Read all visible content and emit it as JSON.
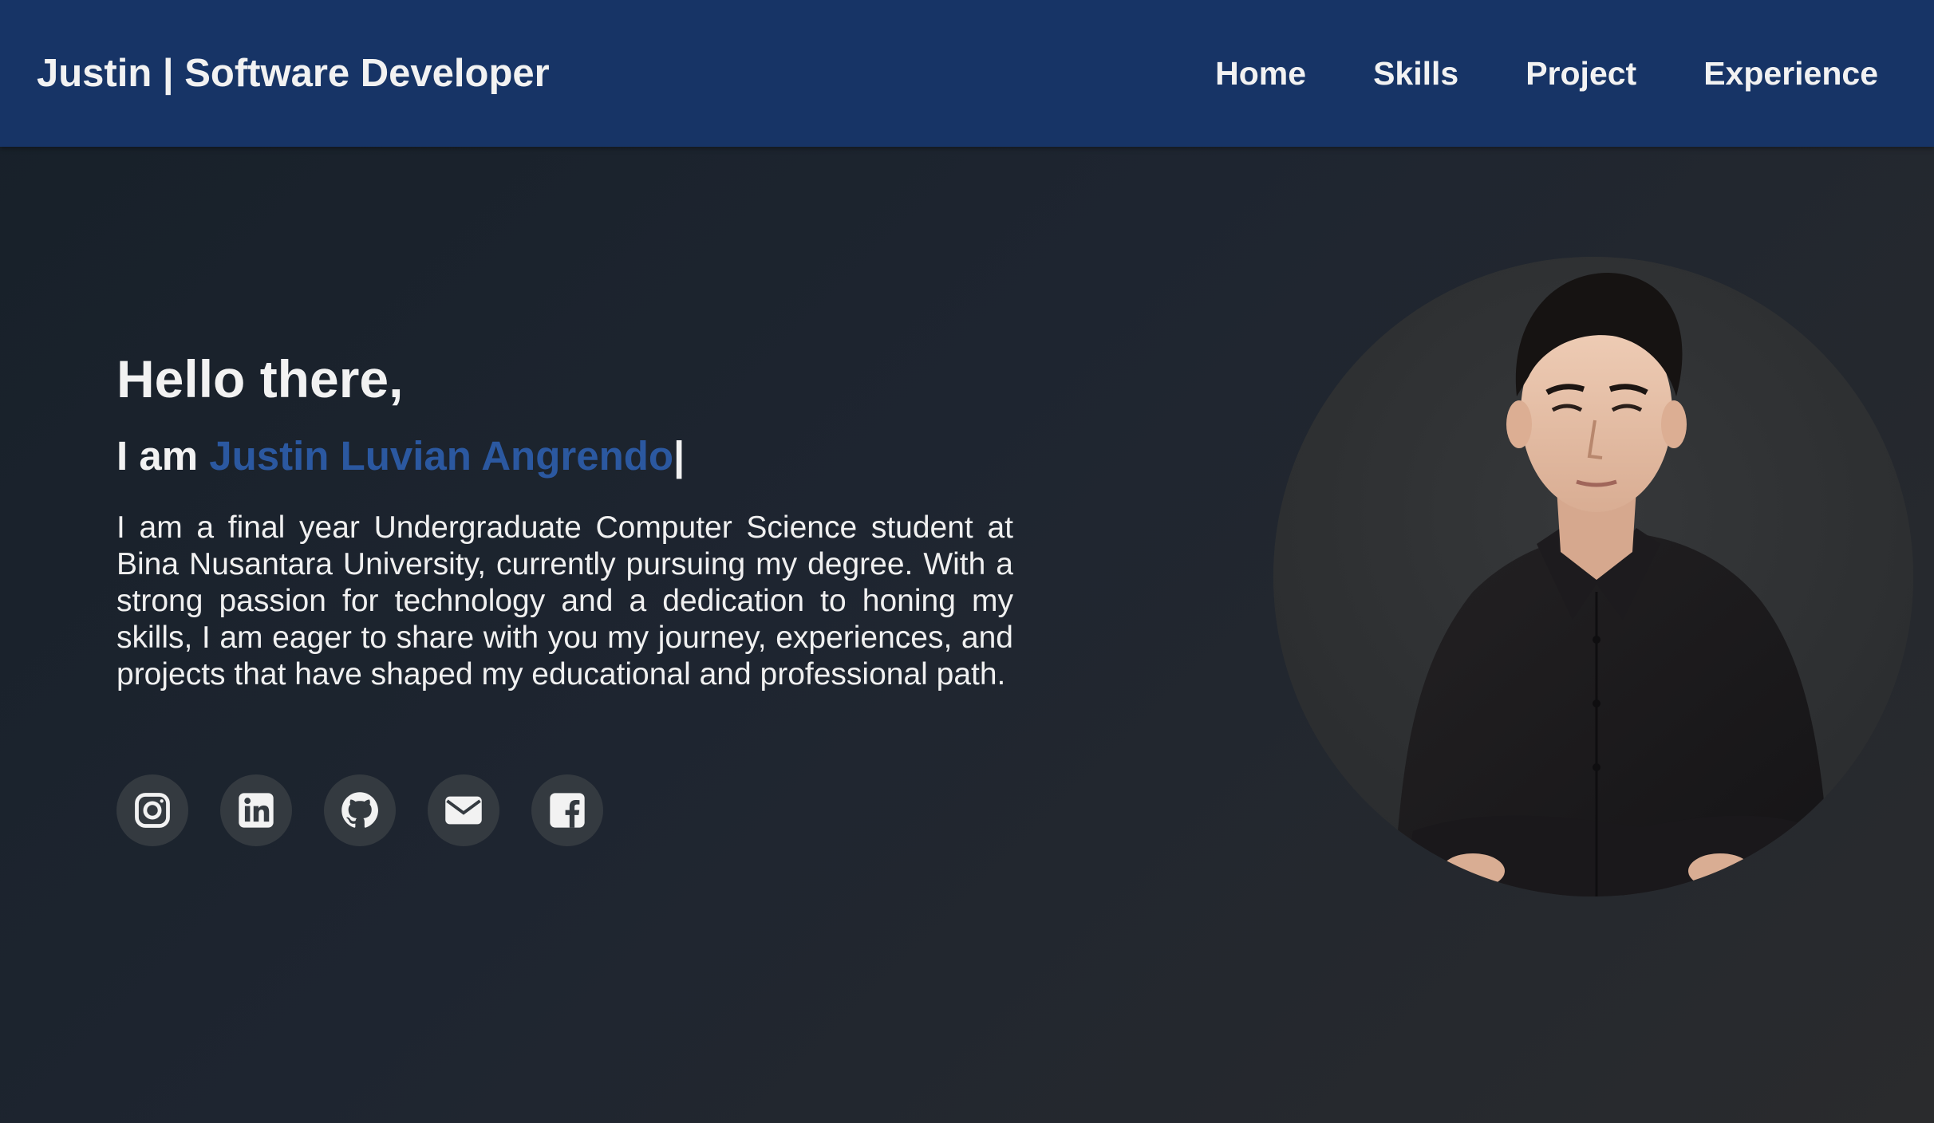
{
  "nav": {
    "brand": "Justin | Software Developer",
    "links": [
      "Home",
      "Skills",
      "Project",
      "Experience"
    ]
  },
  "hero": {
    "greeting": "Hello there,",
    "intro_prefix": "I am ",
    "name": "Justin Luvian Angrendo",
    "cursor": "|",
    "bio": "I am a final year Undergraduate Computer Science student at Bina Nusantara University, currently pursuing my degree. With a strong passion for technology and a dedication to honing my skills, I am eager to share with you my journey, experiences, and projects that have shaped my educational and professional path."
  },
  "socials": [
    {
      "icon": "instagram-icon"
    },
    {
      "icon": "linkedin-icon"
    },
    {
      "icon": "github-icon"
    },
    {
      "icon": "envelope-icon"
    },
    {
      "icon": "facebook-icon"
    }
  ],
  "colors": {
    "navbar": "#173466",
    "accent_name": "#2b58a0",
    "social_bg": "#343a40",
    "text": "#f2f2f2"
  }
}
